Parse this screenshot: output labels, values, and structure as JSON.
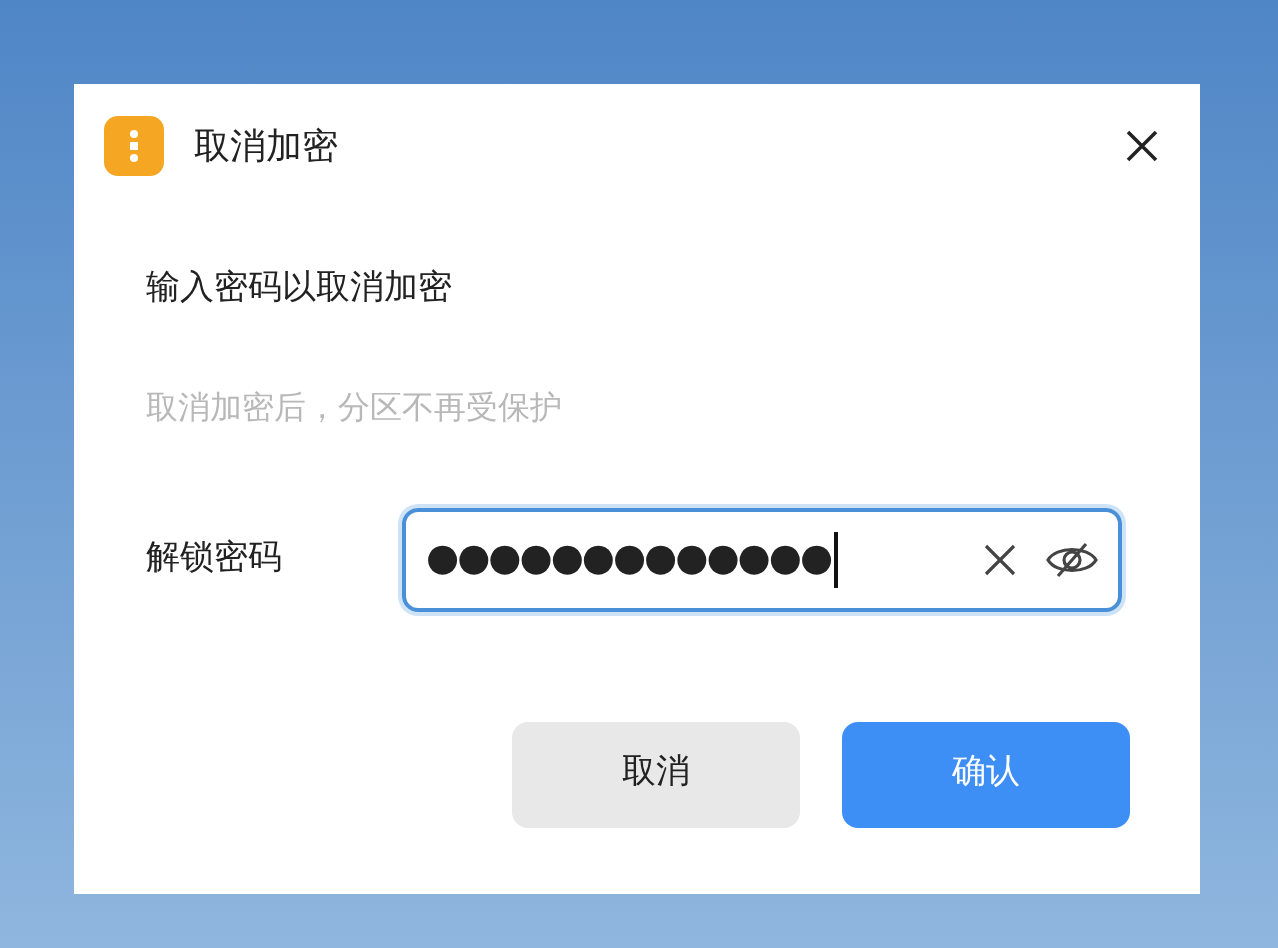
{
  "dialog": {
    "title": "取消加密",
    "heading": "输入密码以取消加密",
    "hint": "取消加密后，分区不再受保护",
    "password_field": {
      "label": "解锁密码",
      "value": "●●●●●●●●●●●●●",
      "focused": true
    },
    "buttons": [
      {
        "label": "取消",
        "kind": "secondary"
      },
      {
        "label": "确认",
        "kind": "primary"
      }
    ]
  }
}
